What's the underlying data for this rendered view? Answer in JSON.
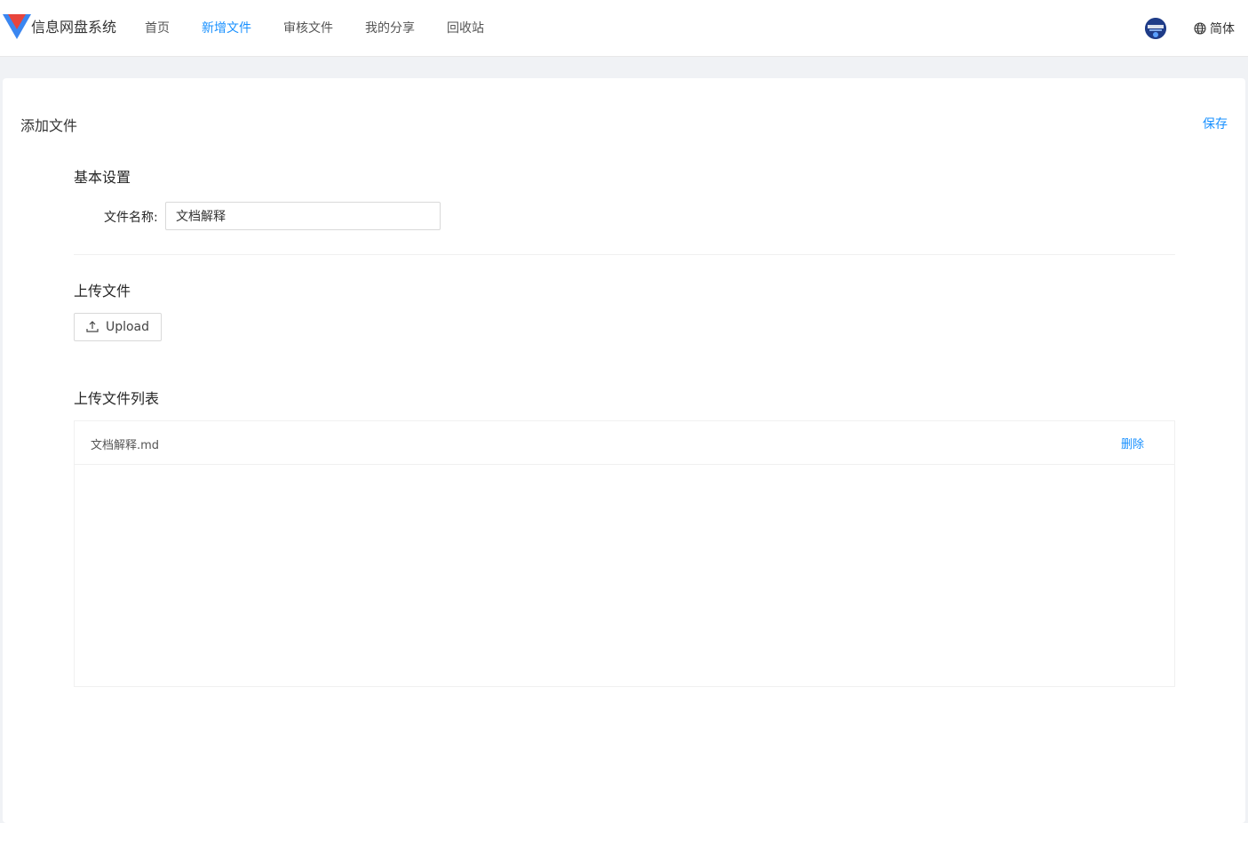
{
  "header": {
    "brand": "信息网盘系统",
    "nav": [
      {
        "label": "首页",
        "active": false
      },
      {
        "label": "新增文件",
        "active": true
      },
      {
        "label": "审核文件",
        "active": false
      },
      {
        "label": "我的分享",
        "active": false
      },
      {
        "label": "回收站",
        "active": false
      }
    ],
    "language": "简体",
    "accent_color": "#1890ff"
  },
  "page": {
    "title": "添加文件",
    "save_label": "保存"
  },
  "basic_settings": {
    "title": "基本设置",
    "file_name_label": "文件名称:",
    "file_name_value": "文档解释"
  },
  "upload": {
    "title": "上传文件",
    "button_label": "Upload"
  },
  "file_list": {
    "title": "上传文件列表",
    "items": [
      {
        "name": "文档解释.md",
        "action": "删除"
      }
    ]
  }
}
